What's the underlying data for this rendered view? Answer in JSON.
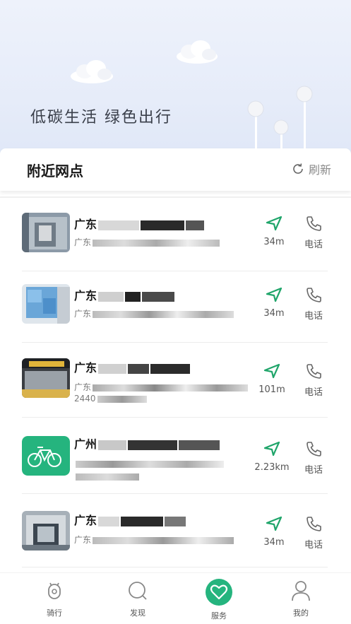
{
  "banner": {
    "slogan": "低碳生活  绿色出行"
  },
  "section": {
    "title": "附近网点",
    "refresh_label": "刷新"
  },
  "colors": {
    "accent": "#25b47e",
    "nav_green": "#1fa56a",
    "text_gray": "#7a7a7a"
  },
  "stores": [
    {
      "name": "广东",
      "address": "广东",
      "address2": "",
      "distance": "34m",
      "call_label": "电话",
      "thumb": "storefront-photo"
    },
    {
      "name": "广东",
      "address": "广东",
      "address2": "",
      "distance": "34m",
      "call_label": "电话",
      "thumb": "blue-sign-photo"
    },
    {
      "name": "广东",
      "address": "广东",
      "address2": "2440",
      "distance": "101m",
      "call_label": "电话",
      "thumb": "shop-front-photo"
    },
    {
      "name": "广州",
      "address": "",
      "address2": "",
      "distance": "2.23km",
      "call_label": "电话",
      "thumb": "bike-logo"
    },
    {
      "name": "广东",
      "address": "广东",
      "address2": "",
      "distance": "34m",
      "call_label": "电话",
      "thumb": "building-photo"
    }
  ],
  "tabbar": {
    "items": [
      {
        "label": "骑行",
        "icon": "scooter-icon",
        "active": false
      },
      {
        "label": "发现",
        "icon": "search-icon",
        "active": false
      },
      {
        "label": "服务",
        "icon": "heart-icon",
        "active": true
      },
      {
        "label": "我的",
        "icon": "user-icon",
        "active": false
      }
    ]
  }
}
